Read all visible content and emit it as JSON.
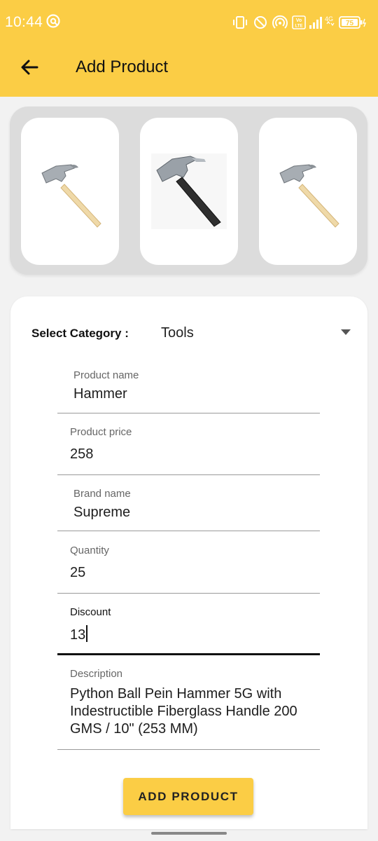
{
  "status_bar": {
    "time": "10:44",
    "battery": "75",
    "network": "4G",
    "icons": [
      "app-notification-icon",
      "vibrate-icon",
      "do-not-disturb-icon",
      "hotspot-icon",
      "volte-icon",
      "signal-icon",
      "battery-icon"
    ]
  },
  "app_bar": {
    "title": "Add Product",
    "back_icon": "arrow-left-icon"
  },
  "images": [
    {
      "name": "claw hammer wooden handle"
    },
    {
      "name": "claw hammer steel handle"
    },
    {
      "name": "claw hammer wooden handle"
    }
  ],
  "form": {
    "category_label": "Select Category :",
    "category_value": "Tools",
    "fields": {
      "product_name": {
        "label": "Product name",
        "value": "Hammer"
      },
      "product_price": {
        "label": "Product price",
        "value": "258"
      },
      "brand_name": {
        "label": "Brand name",
        "value": "Supreme"
      },
      "quantity": {
        "label": "Quantity",
        "value": "25"
      },
      "discount": {
        "label": "Discount",
        "value": "13"
      },
      "description": {
        "label": "Description",
        "value": "Python Ball Pein Hammer 5G with Indestructible Fiberglass Handle 200 GMS / 10\" (253 MM)"
      }
    },
    "submit_label": "ADD PRODUCT"
  },
  "colors": {
    "accent": "#fbcd45",
    "background": "#f2f2f2",
    "card": "#ffffff"
  }
}
